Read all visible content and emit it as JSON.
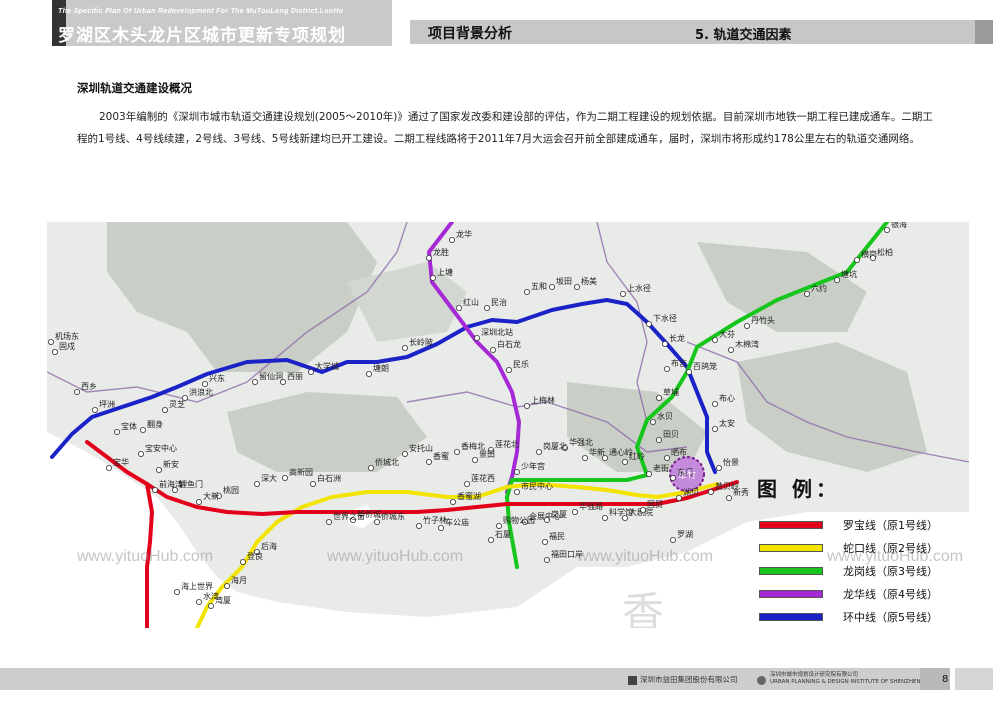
{
  "header": {
    "brand_small": "The Specific Plan Of Urban Redevelopment For The MuTouLong District.LuoHu",
    "brand_title": "罗湖区木头龙片区城市更新专项规划",
    "section": "项目背景分析",
    "subsection": "5. 轨道交通因素"
  },
  "content": {
    "heading": "深圳轨道交通建设概况",
    "paragraph": "2003年编制的《深圳市城市轨道交通建设规划(2005～2010年)》通过了国家发改委和建设部的评估，作为二期工程建设的规划依据。目前深圳市地铁一期工程已建成通车。二期工程的1号线、4号线续建，2号线、3号线、5号线新建均已开工建设。二期工程线路将于2011年7月大运会召开前全部建成通车，届时，深圳市将形成约178公里左右的轨道交通网络。"
  },
  "map": {
    "project_site_label": "翠竹",
    "watermark": "www.yituoHub.com",
    "sea_label": "香",
    "colors": {
      "land": "#e9ebe8",
      "hills": "#c9cec6",
      "water": "#ffffff",
      "district_border": "#8a63a8",
      "line1": "#e3001b",
      "line2": "#f2e400",
      "line3": "#16c61c",
      "line4": "#a52ad6",
      "line5": "#1b22c7"
    },
    "stations": [
      {
        "name": "龙华"
      },
      {
        "name": "龙胜"
      },
      {
        "name": "上塘"
      },
      {
        "name": "红山"
      },
      {
        "name": "民治"
      },
      {
        "name": "五和"
      },
      {
        "name": "坂田"
      },
      {
        "name": "杨美"
      },
      {
        "name": "上水径"
      },
      {
        "name": "下水径"
      },
      {
        "name": "长龙"
      },
      {
        "name": "布吉"
      },
      {
        "name": "百鸽笼"
      },
      {
        "name": "布心"
      },
      {
        "name": "太安"
      },
      {
        "name": "怡景"
      },
      {
        "name": "黄贝岭"
      },
      {
        "name": "新秀"
      },
      {
        "name": "草埔"
      },
      {
        "name": "水贝"
      },
      {
        "name": "田贝"
      },
      {
        "name": "晒布"
      },
      {
        "name": "东门"
      },
      {
        "name": "湖贝"
      },
      {
        "name": "老街"
      },
      {
        "name": "大剧院"
      },
      {
        "name": "国贸"
      },
      {
        "name": "罗湖"
      },
      {
        "name": "科学馆"
      },
      {
        "name": "红岭"
      },
      {
        "name": "通心岭"
      },
      {
        "name": "华新"
      },
      {
        "name": "华强北"
      },
      {
        "name": "华强路"
      },
      {
        "name": "岗厦"
      },
      {
        "name": "岗厦北"
      },
      {
        "name": "会展中心"
      },
      {
        "name": "福民"
      },
      {
        "name": "福田口岸"
      },
      {
        "name": "少年宫"
      },
      {
        "name": "莲花北"
      },
      {
        "name": "景田"
      },
      {
        "name": "香梅北"
      },
      {
        "name": "香蜜"
      },
      {
        "name": "安托山"
      },
      {
        "name": "侨城北"
      },
      {
        "name": "侨城东"
      },
      {
        "name": "华侨城"
      },
      {
        "name": "世界之窗"
      },
      {
        "name": "白石洲"
      },
      {
        "name": "高新园"
      },
      {
        "name": "深大"
      },
      {
        "name": "桃园"
      },
      {
        "name": "大新"
      },
      {
        "name": "鲤鱼门"
      },
      {
        "name": "前海湾"
      },
      {
        "name": "新安"
      },
      {
        "name": "宝安中心"
      },
      {
        "name": "宝华"
      },
      {
        "name": "宝体"
      },
      {
        "name": "坪洲"
      },
      {
        "name": "西乡"
      },
      {
        "name": "固戍"
      },
      {
        "name": "翻身"
      },
      {
        "name": "灵芝"
      },
      {
        "name": "洪浪北"
      },
      {
        "name": "兴东"
      },
      {
        "name": "留仙洞"
      },
      {
        "name": "西丽"
      },
      {
        "name": "大学城"
      },
      {
        "name": "塘朗"
      },
      {
        "name": "长岭陂"
      },
      {
        "name": "深圳北站"
      },
      {
        "name": "白石龙"
      },
      {
        "name": "民乐"
      },
      {
        "name": "上梅林"
      },
      {
        "name": "莲花西"
      },
      {
        "name": "车公庙"
      },
      {
        "name": "竹子林"
      },
      {
        "name": "香蜜湖"
      },
      {
        "name": "购物公园"
      },
      {
        "name": "石厦"
      },
      {
        "name": "市民中心"
      },
      {
        "name": "后海"
      },
      {
        "name": "登良"
      },
      {
        "name": "海月"
      },
      {
        "name": "湾厦"
      },
      {
        "name": "水湾"
      },
      {
        "name": "海上世界"
      },
      {
        "name": "机场东"
      },
      {
        "name": "丹竹头"
      },
      {
        "name": "六约"
      },
      {
        "name": "塘坑"
      },
      {
        "name": "横岗"
      },
      {
        "name": "松柏"
      },
      {
        "name": "木棉湾"
      },
      {
        "name": "大芬"
      },
      {
        "name": "银海"
      },
      {
        "name": "荔枝"
      }
    ]
  },
  "legend": {
    "title": "图 例：",
    "items": [
      {
        "label": "罗宝线（原1号线）",
        "color": "#e3001b"
      },
      {
        "label": "蛇口线（原2号线）",
        "color": "#f2e400"
      },
      {
        "label": "龙岗线（原3号线）",
        "color": "#16c61c"
      },
      {
        "label": "龙华线（原4号线）",
        "color": "#a52ad6"
      },
      {
        "label": "环中线（原5号线）",
        "color": "#1b22c7"
      }
    ]
  },
  "footer": {
    "company1": "深圳市益田集团股份有限公司",
    "company2_line1": "深圳市城市规划设计研究院有限公司",
    "company2_line2": "URBAN PLANNING & DESIGN INSTITUTE OF SHENZHEN",
    "page": "8"
  }
}
